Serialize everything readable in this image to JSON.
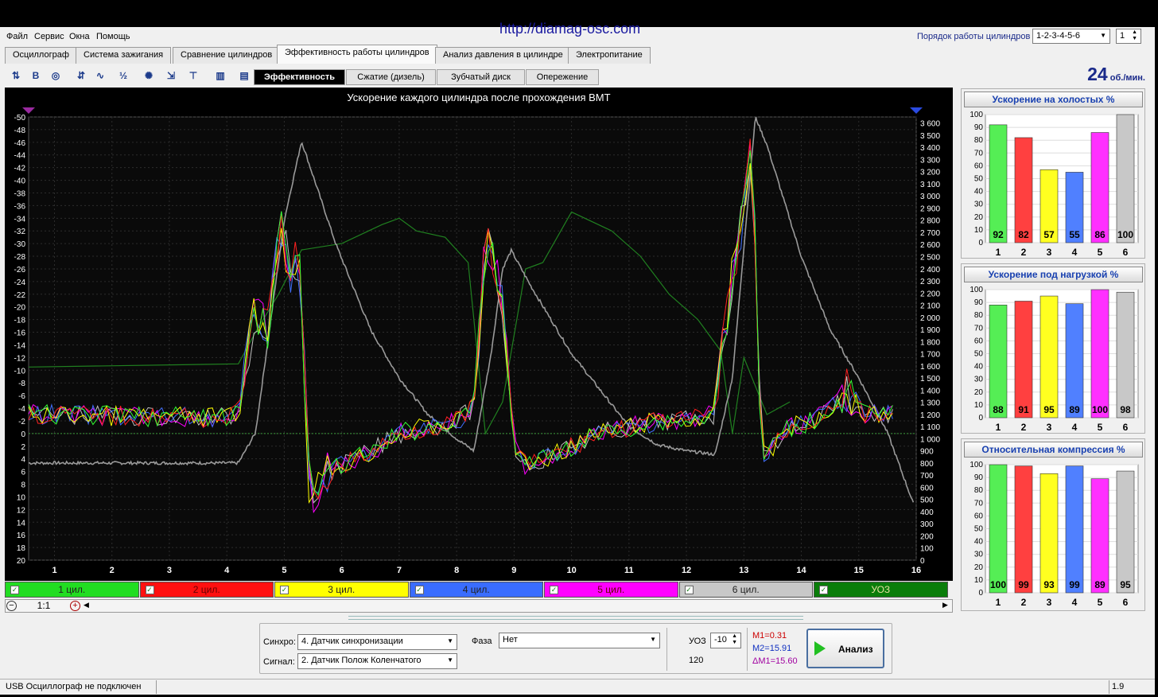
{
  "url": "http://diamag-osc.com",
  "menu": [
    "Файл",
    "Сервис",
    "Окна",
    "Помощь"
  ],
  "firing_order": {
    "label": "Порядок работы цилиндров",
    "value": "1-2-3-4-5-6",
    "stepper": "1"
  },
  "tabs": [
    "Осциллограф",
    "Система зажигания",
    "Сравнение цилиндров",
    "Эффективность работы цилиндров",
    "Анализ давления в цилиндре",
    "Электропитание"
  ],
  "active_tab": 3,
  "subtabs": [
    "Эффективность",
    "Сжатие (дизель)",
    "Зубчатый диск",
    "Опережение"
  ],
  "rpm": {
    "value": "24",
    "unit": "об./мин."
  },
  "toolbar_icons": [
    "pointer-icon",
    "bold-b-icon",
    "rpm-icon",
    "scale-icon",
    "curve-icon",
    "half-icon",
    "filter-icon",
    "numbers-icon",
    "marker-icon",
    "bar-chart-icon",
    "grid-icon"
  ],
  "toolbar_glyphs": [
    "⇅",
    "B",
    "◎",
    "⇵",
    "∿",
    "½",
    "✺",
    "⇲",
    "⊤",
    "▥",
    "▤"
  ],
  "chart_data": {
    "type": "line",
    "title": "Ускорение каждого цилиндра после прохождения ВМТ",
    "x_ticks": [
      "1",
      "2",
      "3",
      "4",
      "5",
      "6",
      "7",
      "8",
      "9",
      "10",
      "11",
      "12",
      "13",
      "14",
      "15",
      "16"
    ],
    "xlim": [
      0.55,
      16
    ],
    "left_ticks": [
      "-50",
      "-48",
      "-46",
      "-44",
      "-42",
      "-40",
      "-38",
      "-36",
      "-34",
      "-32",
      "-30",
      "-28",
      "-26",
      "-24",
      "-22",
      "-20",
      "-18",
      "-16",
      "-14",
      "-12",
      "-10",
      "-8",
      "-6",
      "-4",
      "-2",
      "0",
      "2",
      "4",
      "6",
      "8",
      "10",
      "12",
      "14",
      "16",
      "18",
      "20"
    ],
    "right_ticks": [
      "3 600",
      "3 500",
      "3 400",
      "3 300",
      "3 200",
      "3 100",
      "3 000",
      "2 900",
      "2 800",
      "2 700",
      "2 600",
      "2 500",
      "2 400",
      "2 300",
      "2 200",
      "2 100",
      "2 000",
      "1 900",
      "1 800",
      "1 700",
      "1 600",
      "1 500",
      "1 400",
      "1 300",
      "1 200",
      "1 100",
      "1 000",
      "900",
      "800",
      "700",
      "600",
      "500",
      "400",
      "300",
      "200",
      "100",
      "0"
    ],
    "ylim_left": [
      -50,
      20
    ],
    "ylim_right": [
      0,
      3650
    ],
    "grid": true,
    "series": [
      {
        "name": "1 цил.",
        "color": "#33ff33"
      },
      {
        "name": "2 цил.",
        "color": "#ff2020"
      },
      {
        "name": "3 цил.",
        "color": "#ffff00"
      },
      {
        "name": "4 цил.",
        "color": "#4070ff"
      },
      {
        "name": "5 цил.",
        "color": "#ff00ff"
      },
      {
        "name": "6 цил.",
        "color": "#c0c0c0"
      },
      {
        "name": "УОЗ",
        "color": "#208020"
      }
    ],
    "accel_profile": [
      [
        0.55,
        -3
      ],
      [
        4.0,
        -2.5
      ],
      [
        4.2,
        -3
      ],
      [
        4.5,
        -20
      ],
      [
        4.7,
        -16
      ],
      [
        4.95,
        -33
      ],
      [
        5.1,
        -25
      ],
      [
        5.25,
        -29
      ],
      [
        5.35,
        -10
      ],
      [
        5.45,
        12
      ],
      [
        5.6,
        8
      ],
      [
        5.8,
        6
      ],
      [
        6.0,
        5
      ],
      [
        6.5,
        3
      ],
      [
        7.0,
        0
      ],
      [
        7.5,
        -1
      ],
      [
        8.0,
        -2
      ],
      [
        8.3,
        -4
      ],
      [
        8.5,
        -30
      ],
      [
        8.65,
        -27
      ],
      [
        8.8,
        -20
      ],
      [
        9.0,
        2
      ],
      [
        9.2,
        5
      ],
      [
        9.5,
        4
      ],
      [
        10.0,
        2
      ],
      [
        10.5,
        0
      ],
      [
        11.0,
        -1
      ],
      [
        11.5,
        -2
      ],
      [
        12.0,
        -2
      ],
      [
        12.5,
        -3
      ],
      [
        12.65,
        -15
      ],
      [
        12.8,
        -25
      ],
      [
        13.0,
        -35
      ],
      [
        13.1,
        -47
      ],
      [
        13.2,
        -30
      ],
      [
        13.3,
        4
      ],
      [
        13.5,
        2
      ],
      [
        13.8,
        -1
      ],
      [
        14.2,
        -2
      ],
      [
        14.5,
        -4
      ],
      [
        14.8,
        -7
      ],
      [
        15.1,
        -3
      ],
      [
        15.6,
        -3
      ]
    ],
    "rpm_profile": [
      [
        0.55,
        800
      ],
      [
        4.2,
        800
      ],
      [
        4.5,
        1050
      ],
      [
        5.0,
        2800
      ],
      [
        5.3,
        3450
      ],
      [
        5.9,
        2600
      ],
      [
        6.5,
        1900
      ],
      [
        7.0,
        1500
      ],
      [
        7.5,
        1200
      ],
      [
        8.0,
        1000
      ],
      [
        8.3,
        900
      ],
      [
        8.6,
        1700
      ],
      [
        8.8,
        2400
      ],
      [
        8.95,
        2550
      ],
      [
        9.3,
        2250
      ],
      [
        10.0,
        1700
      ],
      [
        10.5,
        1400
      ],
      [
        11.0,
        1100
      ],
      [
        11.5,
        950
      ],
      [
        12.0,
        900
      ],
      [
        12.5,
        870
      ],
      [
        12.8,
        1500
      ],
      [
        13.2,
        3650
      ],
      [
        13.4,
        3420
      ],
      [
        14.0,
        2500
      ],
      [
        14.5,
        1900
      ],
      [
        15.0,
        1500
      ],
      [
        15.5,
        1050
      ],
      [
        16.0,
        400
      ]
    ],
    "uoz_profile": [
      [
        0.55,
        -10.5
      ],
      [
        4.2,
        -11
      ],
      [
        4.5,
        -16
      ],
      [
        4.9,
        -22
      ],
      [
        5.3,
        -29
      ],
      [
        6.0,
        -30
      ],
      [
        6.7,
        -33
      ],
      [
        7.0,
        -34
      ],
      [
        7.3,
        -32
      ],
      [
        7.8,
        -31
      ],
      [
        8.2,
        -27
      ],
      [
        8.5,
        0
      ],
      [
        8.8,
        -5
      ],
      [
        9.2,
        -26
      ],
      [
        9.5,
        -27
      ],
      [
        10.0,
        -35
      ],
      [
        10.7,
        -32
      ],
      [
        11.2,
        -28
      ],
      [
        11.7,
        -22
      ],
      [
        12.2,
        -18
      ],
      [
        12.6,
        -13
      ],
      [
        12.8,
        0
      ],
      [
        13.0,
        -12
      ],
      [
        13.4,
        -3
      ],
      [
        13.8,
        -5
      ]
    ]
  },
  "cyl_tabs": [
    {
      "label": "1 цил.",
      "color": "#22dd22"
    },
    {
      "label": "2 цил.",
      "color": "#ff1010"
    },
    {
      "label": "3 цил.",
      "color": "#ffff00"
    },
    {
      "label": "4 цил.",
      "color": "#3a6dff"
    },
    {
      "label": "5 цил.",
      "color": "#ff00ff"
    },
    {
      "label": "6 цил.",
      "color": "#c8c8c8"
    },
    {
      "label": "УОЗ",
      "color": "#0a7d0a"
    }
  ],
  "zoom": "1:1",
  "panels": [
    {
      "title": "Ускорение на холостых %",
      "values": [
        92,
        82,
        57,
        55,
        86,
        100
      ]
    },
    {
      "title": "Ускорение под нагрузкой %",
      "values": [
        88,
        91,
        95,
        89,
        100,
        98
      ]
    },
    {
      "title": "Относительная компрессия %",
      "values": [
        100,
        99,
        93,
        99,
        89,
        95
      ]
    }
  ],
  "panel_y_ticks": [
    "100",
    "90",
    "80",
    "70",
    "60",
    "50",
    "40",
    "30",
    "20",
    "10",
    "0"
  ],
  "panel_x_ticks": [
    "1",
    "2",
    "3",
    "4",
    "5",
    "6"
  ],
  "panel_colors": [
    "#55ee55",
    "#ff4040",
    "#ffff20",
    "#5080ff",
    "#ff30ff",
    "#c8c8c8"
  ],
  "controls": {
    "sync_label": "Синхро:",
    "sync_value": "4.  Датчик синхронизации",
    "signal_label": "Сигнал:",
    "signal_value": "2.      Датчик Полож Коленчатого",
    "phase_label": "Фаза",
    "phase_value": "Нет",
    "uoz_label": "УОЗ",
    "uoz_value": "-10",
    "uoz_sub": "120",
    "m1": "M1=0.31",
    "m2": "M2=15.91",
    "dm": "ΔM1=15.60",
    "analyze": "Анализ"
  },
  "status": {
    "left": "USB Осциллограф не подключен",
    "right": "1.9"
  }
}
